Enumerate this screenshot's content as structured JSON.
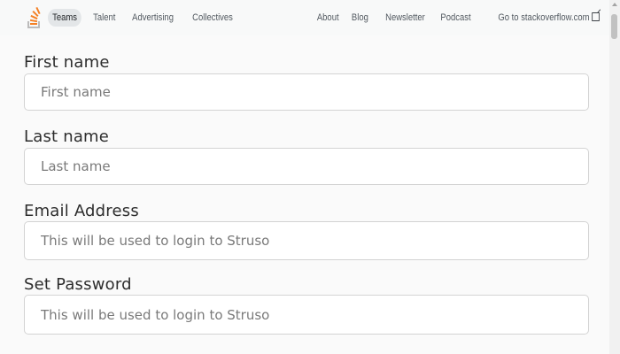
{
  "header": {
    "nav_left": [
      "Teams",
      "Talent",
      "Advertising",
      "Collectives"
    ],
    "nav_right": [
      "About",
      "Blog",
      "Newsletter",
      "Podcast",
      "Go to stackoverflow.com"
    ],
    "logo_icon": "stackoverflow-logo-icon",
    "external_icon": "external-link-icon"
  },
  "form": {
    "first_name": {
      "label": "First name",
      "placeholder": "First name"
    },
    "last_name": {
      "label": "Last name",
      "placeholder": "Last name"
    },
    "email": {
      "label": "Email Address",
      "placeholder": "This will be used to login to Struso"
    },
    "password": {
      "label": "Set Password",
      "placeholder": "This will be used to login to Struso"
    }
  },
  "colors": {
    "logo_orange": "#f48024",
    "logo_gray": "#bcbbbb",
    "active_tab_bg": "#e3e6e8"
  }
}
